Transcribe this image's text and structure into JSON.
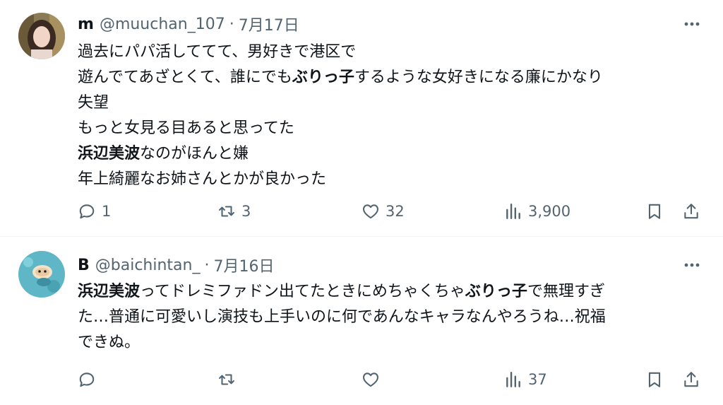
{
  "tweets": [
    {
      "name": "m",
      "handle": "@muuchan_107",
      "separator": "·",
      "date": "7月17日",
      "lines": [
        [
          {
            "t": "過去にパパ活しててて、男好きで港区で"
          }
        ],
        [
          {
            "t": "遊んでてあざとくて、誰にでも"
          },
          {
            "t": "ぶりっ子",
            "b": true
          },
          {
            "t": "するような女好きになる廉にかなり"
          }
        ],
        [
          {
            "t": "失望"
          }
        ],
        [
          {
            "t": "もっと女見る目あると思ってた"
          }
        ],
        [
          {
            "t": "浜辺美波",
            "b": true
          },
          {
            "t": "なのがほんと嫌"
          }
        ],
        [
          {
            "t": "年上綺麗なお姉さんとかが良かった"
          }
        ]
      ],
      "actions": {
        "reply": "1",
        "retweet": "3",
        "like": "32",
        "views": "3,900"
      }
    },
    {
      "name": "B",
      "handle": "@baichintan_",
      "separator": "·",
      "date": "7月16日",
      "lines": [
        [
          {
            "t": "浜辺美波",
            "b": true
          },
          {
            "t": "ってドレミファドン出てたときにめちゃくちゃ"
          },
          {
            "t": "ぶりっ子",
            "b": true
          },
          {
            "t": "で無理すぎ"
          }
        ],
        [
          {
            "t": "た…普通に可愛いし演技も上手いのに何であんなキャラなんやろうね…祝福"
          }
        ],
        [
          {
            "t": "できぬ。"
          }
        ]
      ],
      "actions": {
        "reply": "",
        "retweet": "",
        "like": "",
        "views": "37"
      }
    }
  ],
  "icons": {
    "reply": "reply-icon",
    "retweet": "retweet-icon",
    "like": "like-icon",
    "views": "views-icon",
    "bookmark": "bookmark-icon",
    "share": "share-icon",
    "more": "more-icon"
  },
  "colors": {
    "text": "#0f1419",
    "secondary": "#536471",
    "divider": "#eff3f4"
  }
}
